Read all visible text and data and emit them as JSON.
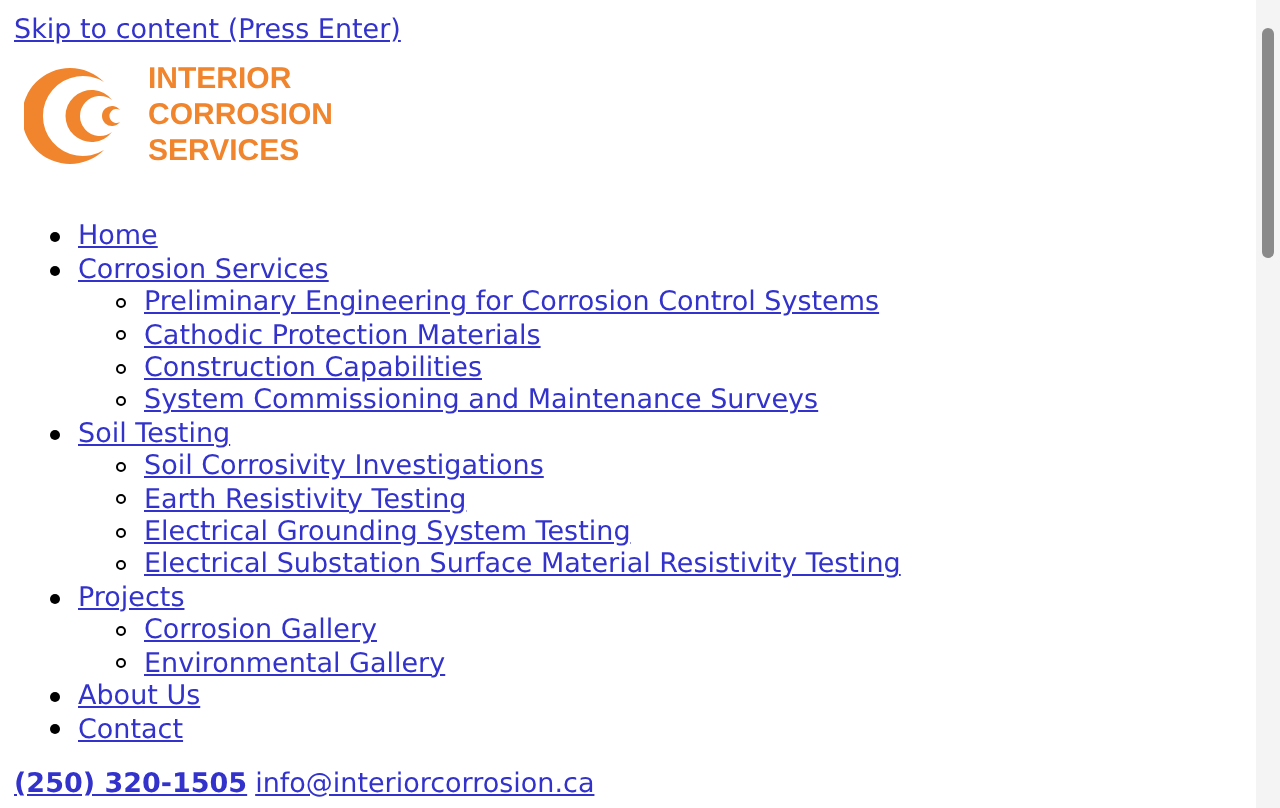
{
  "skip_link": "Skip to content (Press Enter)",
  "logo": {
    "lines": [
      "INTERIOR",
      "CORROSION",
      "SERVICES"
    ]
  },
  "nav": [
    {
      "label": "Home"
    },
    {
      "label": "Corrosion Services",
      "children": [
        {
          "label": "Preliminary Engineering for Corrosion Control Systems"
        },
        {
          "label": "Cathodic Protection Materials"
        },
        {
          "label": "Construction Capabilities"
        },
        {
          "label": "System Commissioning and Maintenance Surveys"
        }
      ]
    },
    {
      "label": "Soil Testing",
      "children": [
        {
          "label": "Soil Corrosivity Investigations"
        },
        {
          "label": "Earth Resistivity Testing"
        },
        {
          "label": "Electrical Grounding System Testing"
        },
        {
          "label": "Electrical Substation Surface Material Resistivity Testing"
        }
      ]
    },
    {
      "label": "Projects",
      "children": [
        {
          "label": "Corrosion Gallery"
        },
        {
          "label": "Environmental Gallery"
        }
      ]
    },
    {
      "label": "About Us"
    },
    {
      "label": "Contact"
    }
  ],
  "contact": {
    "phone": "(250) 320-1505",
    "email": "info@interiorcorrosion.ca"
  }
}
